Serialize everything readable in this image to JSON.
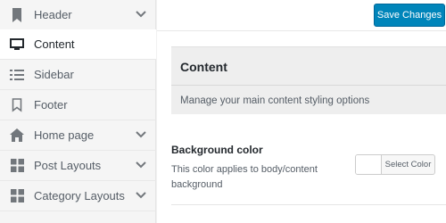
{
  "sidebar": {
    "items": [
      {
        "label": "Header",
        "icon": "bookmark-icon",
        "has_chevron": true,
        "active": false
      },
      {
        "label": "Content",
        "icon": "monitor-icon",
        "has_chevron": false,
        "active": true
      },
      {
        "label": "Sidebar",
        "icon": "list-icon",
        "has_chevron": false,
        "active": false
      },
      {
        "label": "Footer",
        "icon": "bookmark-outline-icon",
        "has_chevron": false,
        "active": false
      },
      {
        "label": "Home page",
        "icon": "home-icon",
        "has_chevron": true,
        "active": false
      },
      {
        "label": "Post Layouts",
        "icon": "grid-icon",
        "has_chevron": true,
        "active": false
      },
      {
        "label": "Category Layouts",
        "icon": "grid-icon",
        "has_chevron": true,
        "active": false
      }
    ]
  },
  "toolbar": {
    "save_label": "Save Changes"
  },
  "panel": {
    "title": "Content",
    "description": "Manage your main content styling options"
  },
  "setting": {
    "title": "Background color",
    "description": "This color applies to body/content background",
    "button_label": "Select Color",
    "current_color": "#ffffff"
  },
  "colors": {
    "accent": "#0085ba",
    "sidebar_bg": "#f5f5f5",
    "icon": "#72777c"
  }
}
